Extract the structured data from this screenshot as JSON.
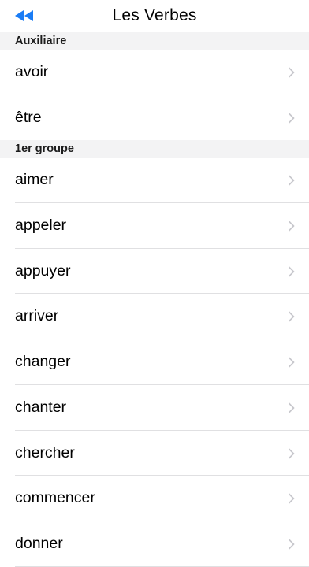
{
  "nav": {
    "title": "Les Verbes",
    "back_icon": "rewind-icon",
    "accent_color": "#1a7cf5"
  },
  "sections": [
    {
      "header": "Auxiliaire",
      "items": [
        {
          "label": "avoir"
        },
        {
          "label": "être"
        }
      ]
    },
    {
      "header": "1er groupe",
      "items": [
        {
          "label": "aimer"
        },
        {
          "label": "appeler"
        },
        {
          "label": "appuyer"
        },
        {
          "label": "arriver"
        },
        {
          "label": "changer"
        },
        {
          "label": "chanter"
        },
        {
          "label": "chercher"
        },
        {
          "label": "commencer"
        },
        {
          "label": "donner"
        }
      ]
    }
  ],
  "row_icon": "chevron-right-icon"
}
